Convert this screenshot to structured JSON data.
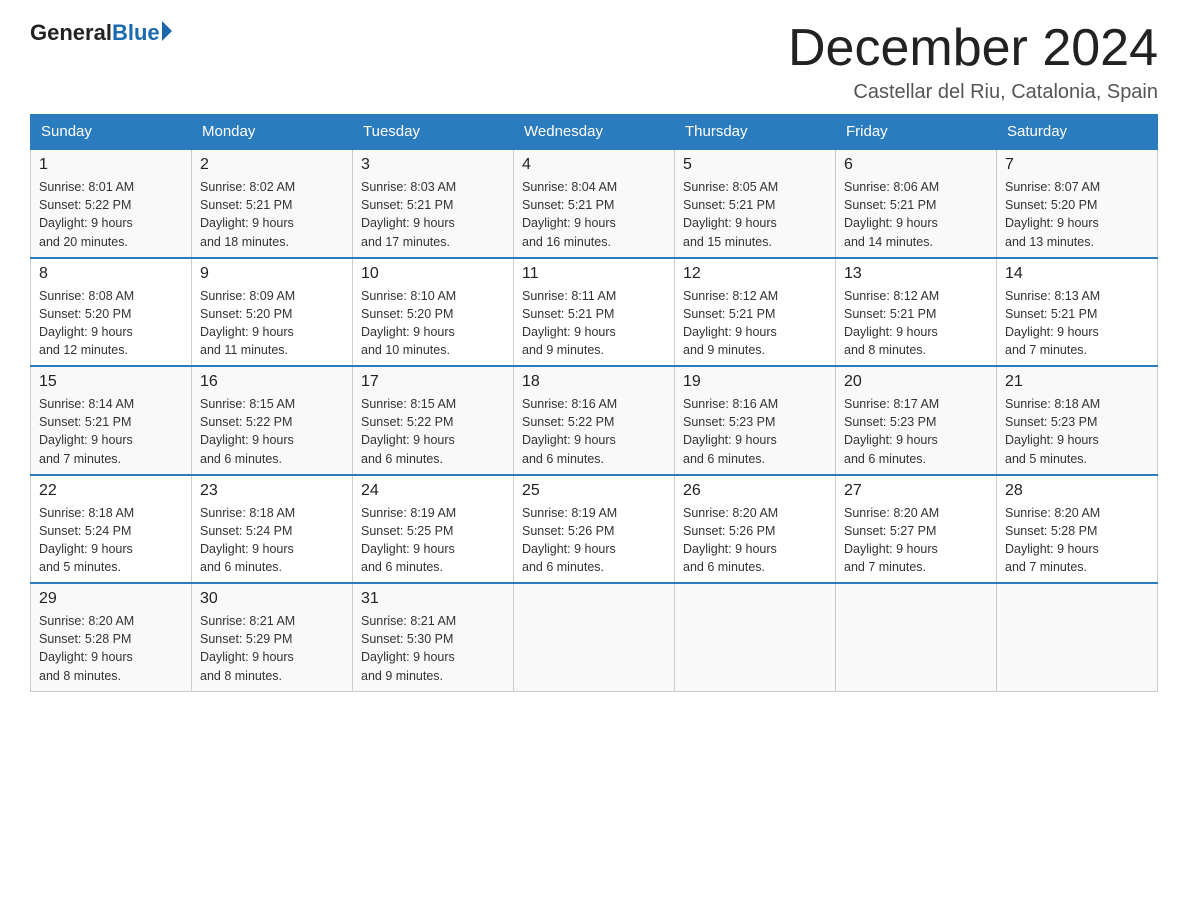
{
  "header": {
    "logo_general": "General",
    "logo_blue": "Blue",
    "month_title": "December 2024",
    "location": "Castellar del Riu, Catalonia, Spain"
  },
  "days_of_week": [
    "Sunday",
    "Monday",
    "Tuesday",
    "Wednesday",
    "Thursday",
    "Friday",
    "Saturday"
  ],
  "weeks": [
    [
      {
        "day": "1",
        "sunrise": "8:01 AM",
        "sunset": "5:22 PM",
        "daylight": "9 hours and 20 minutes."
      },
      {
        "day": "2",
        "sunrise": "8:02 AM",
        "sunset": "5:21 PM",
        "daylight": "9 hours and 18 minutes."
      },
      {
        "day": "3",
        "sunrise": "8:03 AM",
        "sunset": "5:21 PM",
        "daylight": "9 hours and 17 minutes."
      },
      {
        "day": "4",
        "sunrise": "8:04 AM",
        "sunset": "5:21 PM",
        "daylight": "9 hours and 16 minutes."
      },
      {
        "day": "5",
        "sunrise": "8:05 AM",
        "sunset": "5:21 PM",
        "daylight": "9 hours and 15 minutes."
      },
      {
        "day": "6",
        "sunrise": "8:06 AM",
        "sunset": "5:21 PM",
        "daylight": "9 hours and 14 minutes."
      },
      {
        "day": "7",
        "sunrise": "8:07 AM",
        "sunset": "5:20 PM",
        "daylight": "9 hours and 13 minutes."
      }
    ],
    [
      {
        "day": "8",
        "sunrise": "8:08 AM",
        "sunset": "5:20 PM",
        "daylight": "9 hours and 12 minutes."
      },
      {
        "day": "9",
        "sunrise": "8:09 AM",
        "sunset": "5:20 PM",
        "daylight": "9 hours and 11 minutes."
      },
      {
        "day": "10",
        "sunrise": "8:10 AM",
        "sunset": "5:20 PM",
        "daylight": "9 hours and 10 minutes."
      },
      {
        "day": "11",
        "sunrise": "8:11 AM",
        "sunset": "5:21 PM",
        "daylight": "9 hours and 9 minutes."
      },
      {
        "day": "12",
        "sunrise": "8:12 AM",
        "sunset": "5:21 PM",
        "daylight": "9 hours and 9 minutes."
      },
      {
        "day": "13",
        "sunrise": "8:12 AM",
        "sunset": "5:21 PM",
        "daylight": "9 hours and 8 minutes."
      },
      {
        "day": "14",
        "sunrise": "8:13 AM",
        "sunset": "5:21 PM",
        "daylight": "9 hours and 7 minutes."
      }
    ],
    [
      {
        "day": "15",
        "sunrise": "8:14 AM",
        "sunset": "5:21 PM",
        "daylight": "9 hours and 7 minutes."
      },
      {
        "day": "16",
        "sunrise": "8:15 AM",
        "sunset": "5:22 PM",
        "daylight": "9 hours and 6 minutes."
      },
      {
        "day": "17",
        "sunrise": "8:15 AM",
        "sunset": "5:22 PM",
        "daylight": "9 hours and 6 minutes."
      },
      {
        "day": "18",
        "sunrise": "8:16 AM",
        "sunset": "5:22 PM",
        "daylight": "9 hours and 6 minutes."
      },
      {
        "day": "19",
        "sunrise": "8:16 AM",
        "sunset": "5:23 PM",
        "daylight": "9 hours and 6 minutes."
      },
      {
        "day": "20",
        "sunrise": "8:17 AM",
        "sunset": "5:23 PM",
        "daylight": "9 hours and 6 minutes."
      },
      {
        "day": "21",
        "sunrise": "8:18 AM",
        "sunset": "5:23 PM",
        "daylight": "9 hours and 5 minutes."
      }
    ],
    [
      {
        "day": "22",
        "sunrise": "8:18 AM",
        "sunset": "5:24 PM",
        "daylight": "9 hours and 5 minutes."
      },
      {
        "day": "23",
        "sunrise": "8:18 AM",
        "sunset": "5:24 PM",
        "daylight": "9 hours and 6 minutes."
      },
      {
        "day": "24",
        "sunrise": "8:19 AM",
        "sunset": "5:25 PM",
        "daylight": "9 hours and 6 minutes."
      },
      {
        "day": "25",
        "sunrise": "8:19 AM",
        "sunset": "5:26 PM",
        "daylight": "9 hours and 6 minutes."
      },
      {
        "day": "26",
        "sunrise": "8:20 AM",
        "sunset": "5:26 PM",
        "daylight": "9 hours and 6 minutes."
      },
      {
        "day": "27",
        "sunrise": "8:20 AM",
        "sunset": "5:27 PM",
        "daylight": "9 hours and 7 minutes."
      },
      {
        "day": "28",
        "sunrise": "8:20 AM",
        "sunset": "5:28 PM",
        "daylight": "9 hours and 7 minutes."
      }
    ],
    [
      {
        "day": "29",
        "sunrise": "8:20 AM",
        "sunset": "5:28 PM",
        "daylight": "9 hours and 8 minutes."
      },
      {
        "day": "30",
        "sunrise": "8:21 AM",
        "sunset": "5:29 PM",
        "daylight": "9 hours and 8 minutes."
      },
      {
        "day": "31",
        "sunrise": "8:21 AM",
        "sunset": "5:30 PM",
        "daylight": "9 hours and 9 minutes."
      },
      null,
      null,
      null,
      null
    ]
  ],
  "labels": {
    "sunrise": "Sunrise:",
    "sunset": "Sunset:",
    "daylight": "Daylight:"
  }
}
